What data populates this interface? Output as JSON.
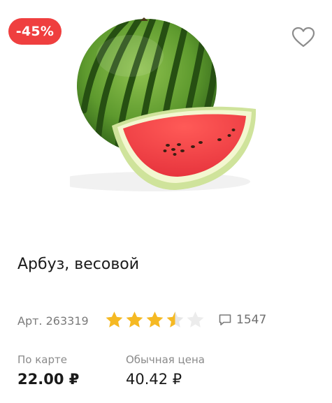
{
  "product": {
    "discount_badge": "-45%",
    "title": "Арбуз, весовой",
    "article": "Арт. 263319",
    "rating": 3.5,
    "rating_max": 5,
    "reviews_count": "1547",
    "image_icon": "watermelon-image",
    "favorite_icon": "heart-icon",
    "comment_icon": "comment-icon"
  },
  "prices": {
    "card_label": "По карте",
    "card_price": "22.00 ₽",
    "regular_label": "Обычная цена",
    "regular_price": "40.42 ₽"
  },
  "colors": {
    "badge": "#ef3f3f",
    "star_filled": "#f5b923",
    "star_empty": "#e6e6e6"
  }
}
